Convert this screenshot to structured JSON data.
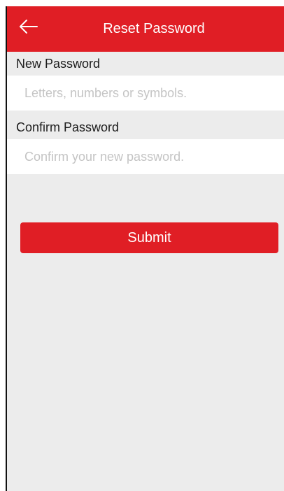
{
  "header": {
    "back_icon": "arrow-left-icon",
    "title": "Reset Password"
  },
  "form": {
    "new_password": {
      "label": "New Password",
      "value": "",
      "placeholder": "Letters, numbers or symbols."
    },
    "confirm_password": {
      "label": "Confirm Password",
      "value": "",
      "placeholder": "Confirm your new password."
    },
    "submit_label": "Submit"
  },
  "colors": {
    "accent": "#e01e25",
    "background": "#ececec",
    "field_background": "#ffffff",
    "placeholder": "#c4c4c4"
  }
}
